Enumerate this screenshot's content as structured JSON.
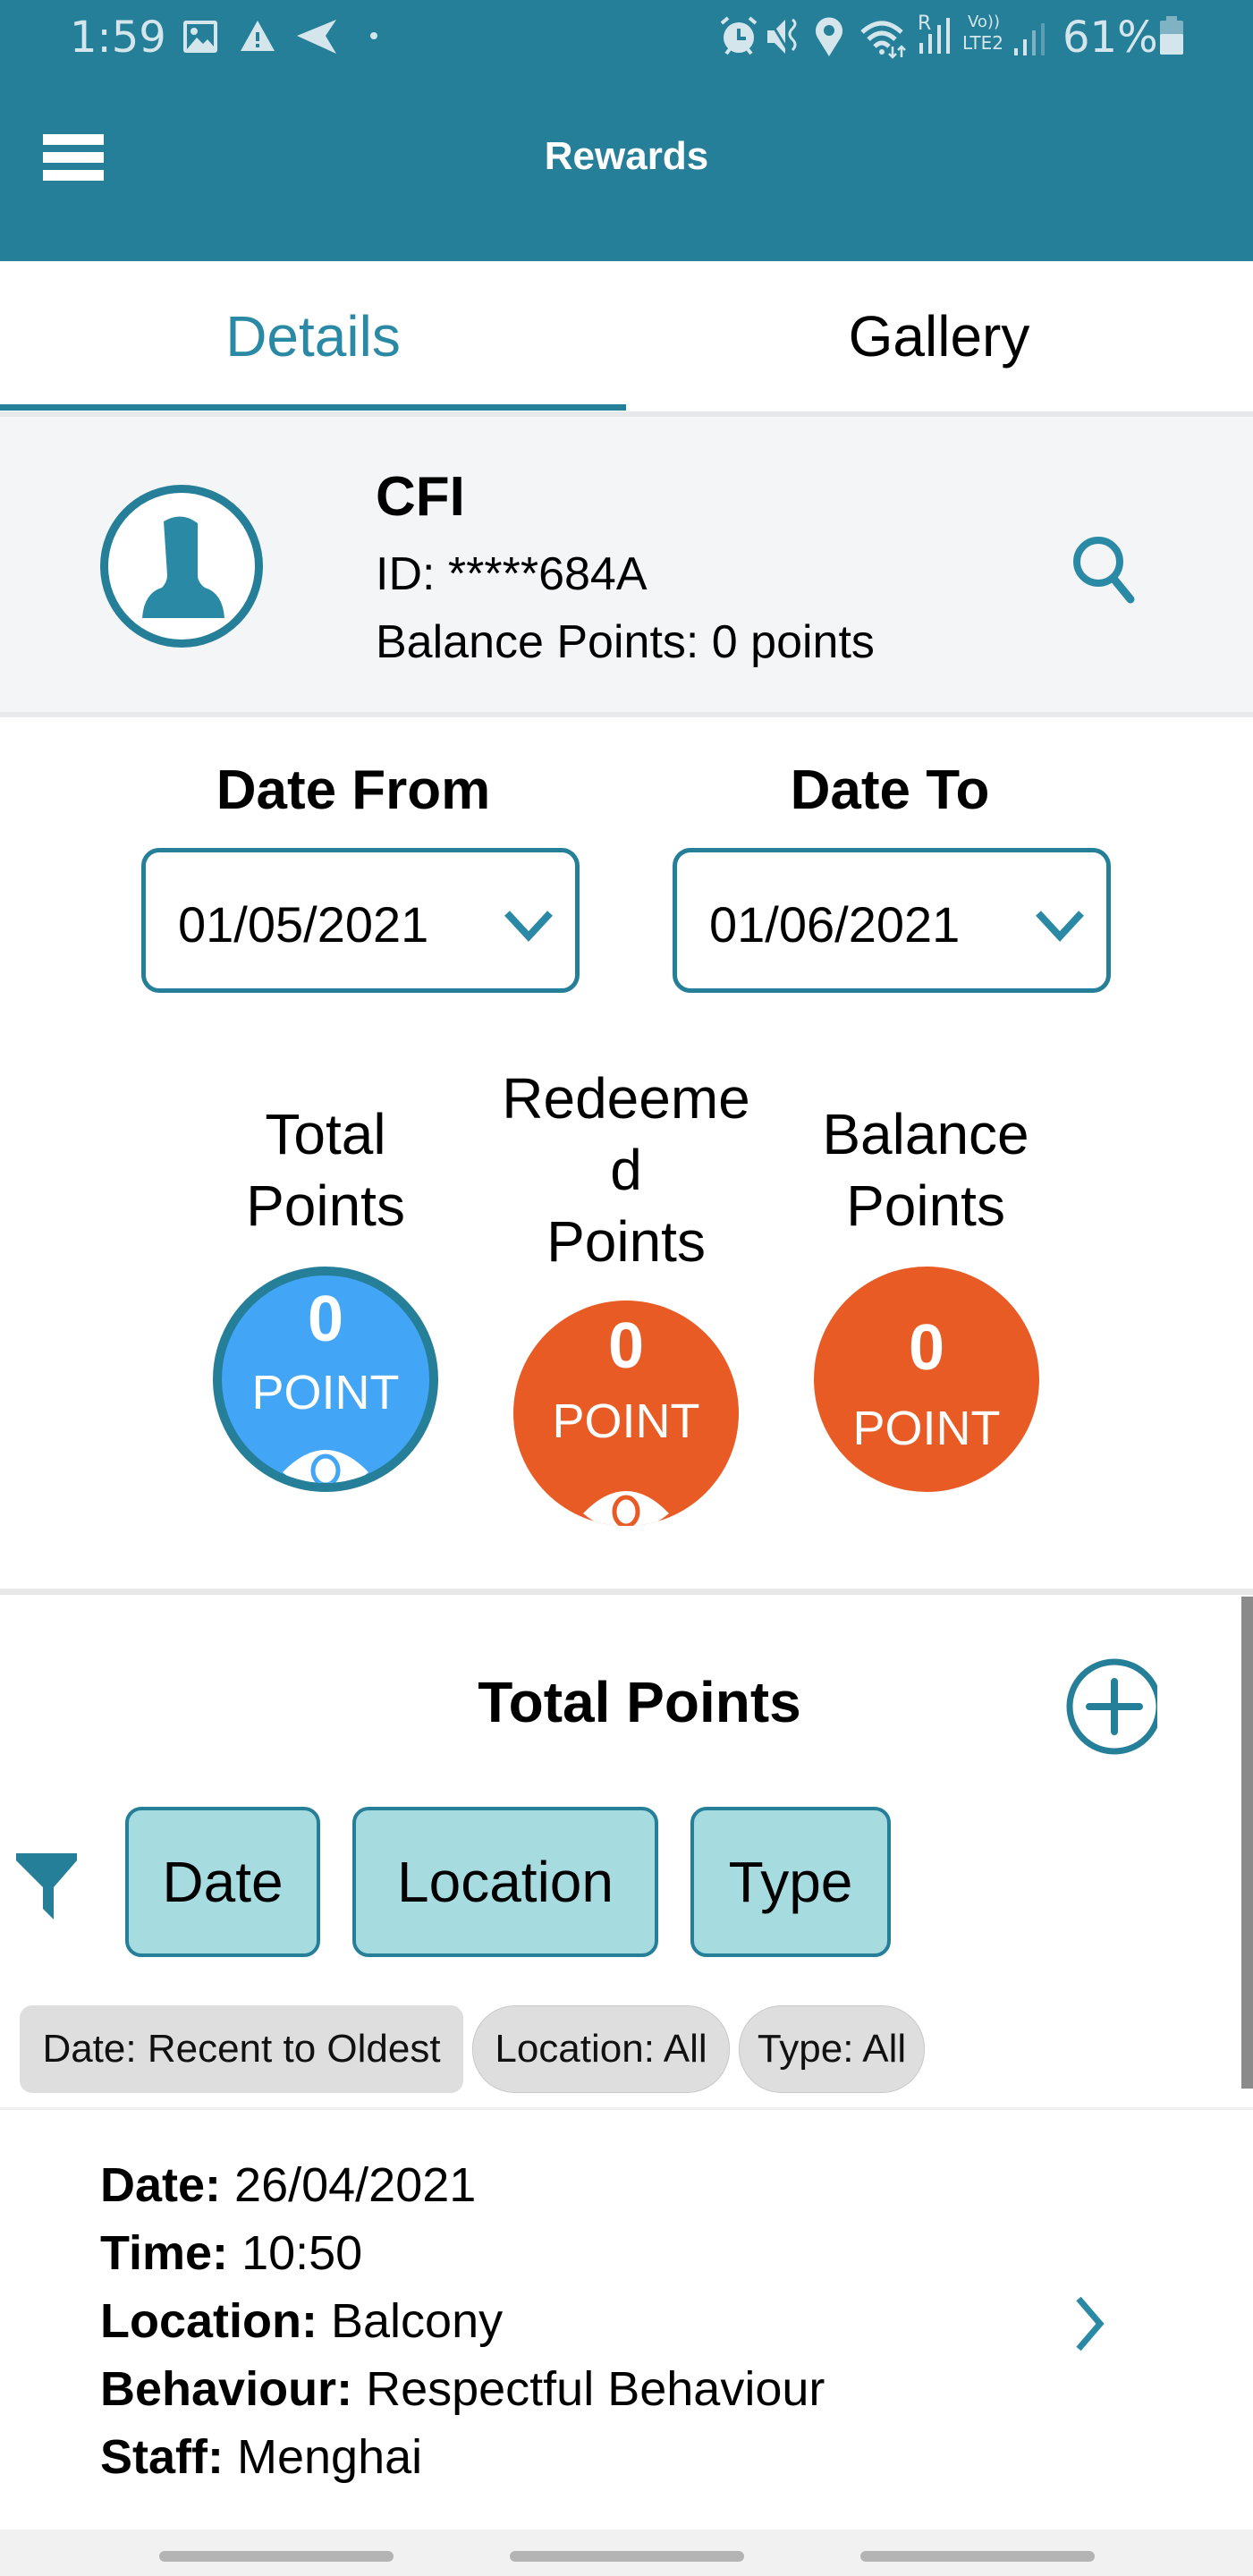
{
  "status_bar": {
    "time": "1:59",
    "left_icons": [
      "gallery-icon",
      "warning-icon",
      "send-icon",
      "dot-icon"
    ],
    "right_icons": [
      "alarm-icon",
      "vibrate-icon",
      "location-icon",
      "wifi-icon",
      "signal-roaming-icon",
      "volte-lte2-signal-icon"
    ],
    "roaming_label": "R",
    "volte_label": "Vo))",
    "lte_label": "LTE2",
    "battery": "61%"
  },
  "header": {
    "title": "Rewards",
    "menu_icon": "hamburger-menu-icon"
  },
  "tabs": [
    {
      "label": "Details",
      "active": true
    },
    {
      "label": "Gallery",
      "active": false
    }
  ],
  "profile": {
    "name": "CFI",
    "id": "ID: *****684A",
    "balance": "Balance Points: 0 points",
    "avatar_icon": "person-icon",
    "search_icon": "search-icon"
  },
  "date_filter": {
    "from_label": "Date From",
    "from_value": "01/05/2021",
    "to_label": "Date To",
    "to_value": "01/06/2021"
  },
  "points_summary": [
    {
      "label_lines": [
        "Total",
        "Points"
      ],
      "value": "0",
      "unit": "POINT",
      "color": "#43a5f5",
      "has_eye": true
    },
    {
      "label_lines": [
        "Redeeme",
        "d",
        "Points"
      ],
      "value": "0",
      "unit": "POINT",
      "color": "#e85b24",
      "has_eye": true
    },
    {
      "label_lines": [
        "Balance",
        "Points"
      ],
      "value": "0",
      "unit": "POINT",
      "color": "#e85b24",
      "has_eye": false
    }
  ],
  "list": {
    "title": "Total Points",
    "filter_buttons": [
      "Date",
      "Location",
      "Type"
    ],
    "active_filters": [
      "Date: Recent to Oldest",
      "Location: All",
      "Type: All"
    ],
    "records": [
      {
        "fields": [
          {
            "key": "Date:",
            "value": "26/04/2021"
          },
          {
            "key": "Time:",
            "value": "10:50"
          },
          {
            "key": "Location:",
            "value": "Balcony"
          },
          {
            "key": "Behaviour:",
            "value": "Respectful Behaviour"
          },
          {
            "key": "Staff:",
            "value": "Menghai"
          }
        ]
      }
    ]
  },
  "colors": {
    "primary": "#267f99",
    "tab_active": "#2a8aa5",
    "total_points": "#43a5f5",
    "redeemed_points": "#e85b24",
    "balance_points": "#e85b24",
    "filter_button_bg": "#a6dbe0",
    "chip_bg": "#dedede"
  }
}
